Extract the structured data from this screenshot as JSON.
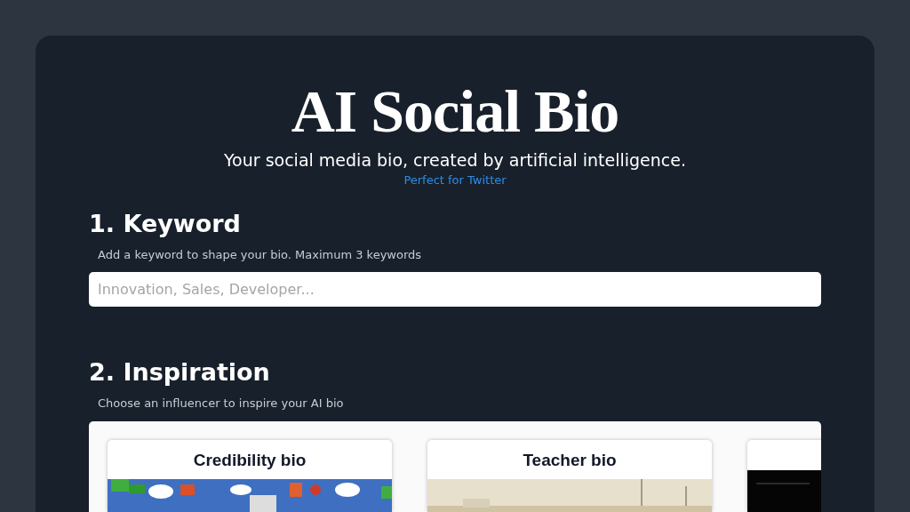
{
  "header": {
    "title": "AI Social Bio",
    "subtitle": "Your social media bio, created by artificial intelligence.",
    "link": "Perfect for Twitter"
  },
  "keyword": {
    "heading": "1. Keyword",
    "hint": "Add a keyword to shape your bio. Maximum 3 keywords",
    "placeholder": "Innovation, Sales, Developer..."
  },
  "inspiration": {
    "heading": "2. Inspiration",
    "hint": "Choose an influencer to inspire your AI bio",
    "cards": [
      {
        "title": "Credibility bio",
        "kind": "game"
      },
      {
        "title": "Teacher bio",
        "kind": "city"
      },
      {
        "kind": "dark"
      }
    ]
  }
}
